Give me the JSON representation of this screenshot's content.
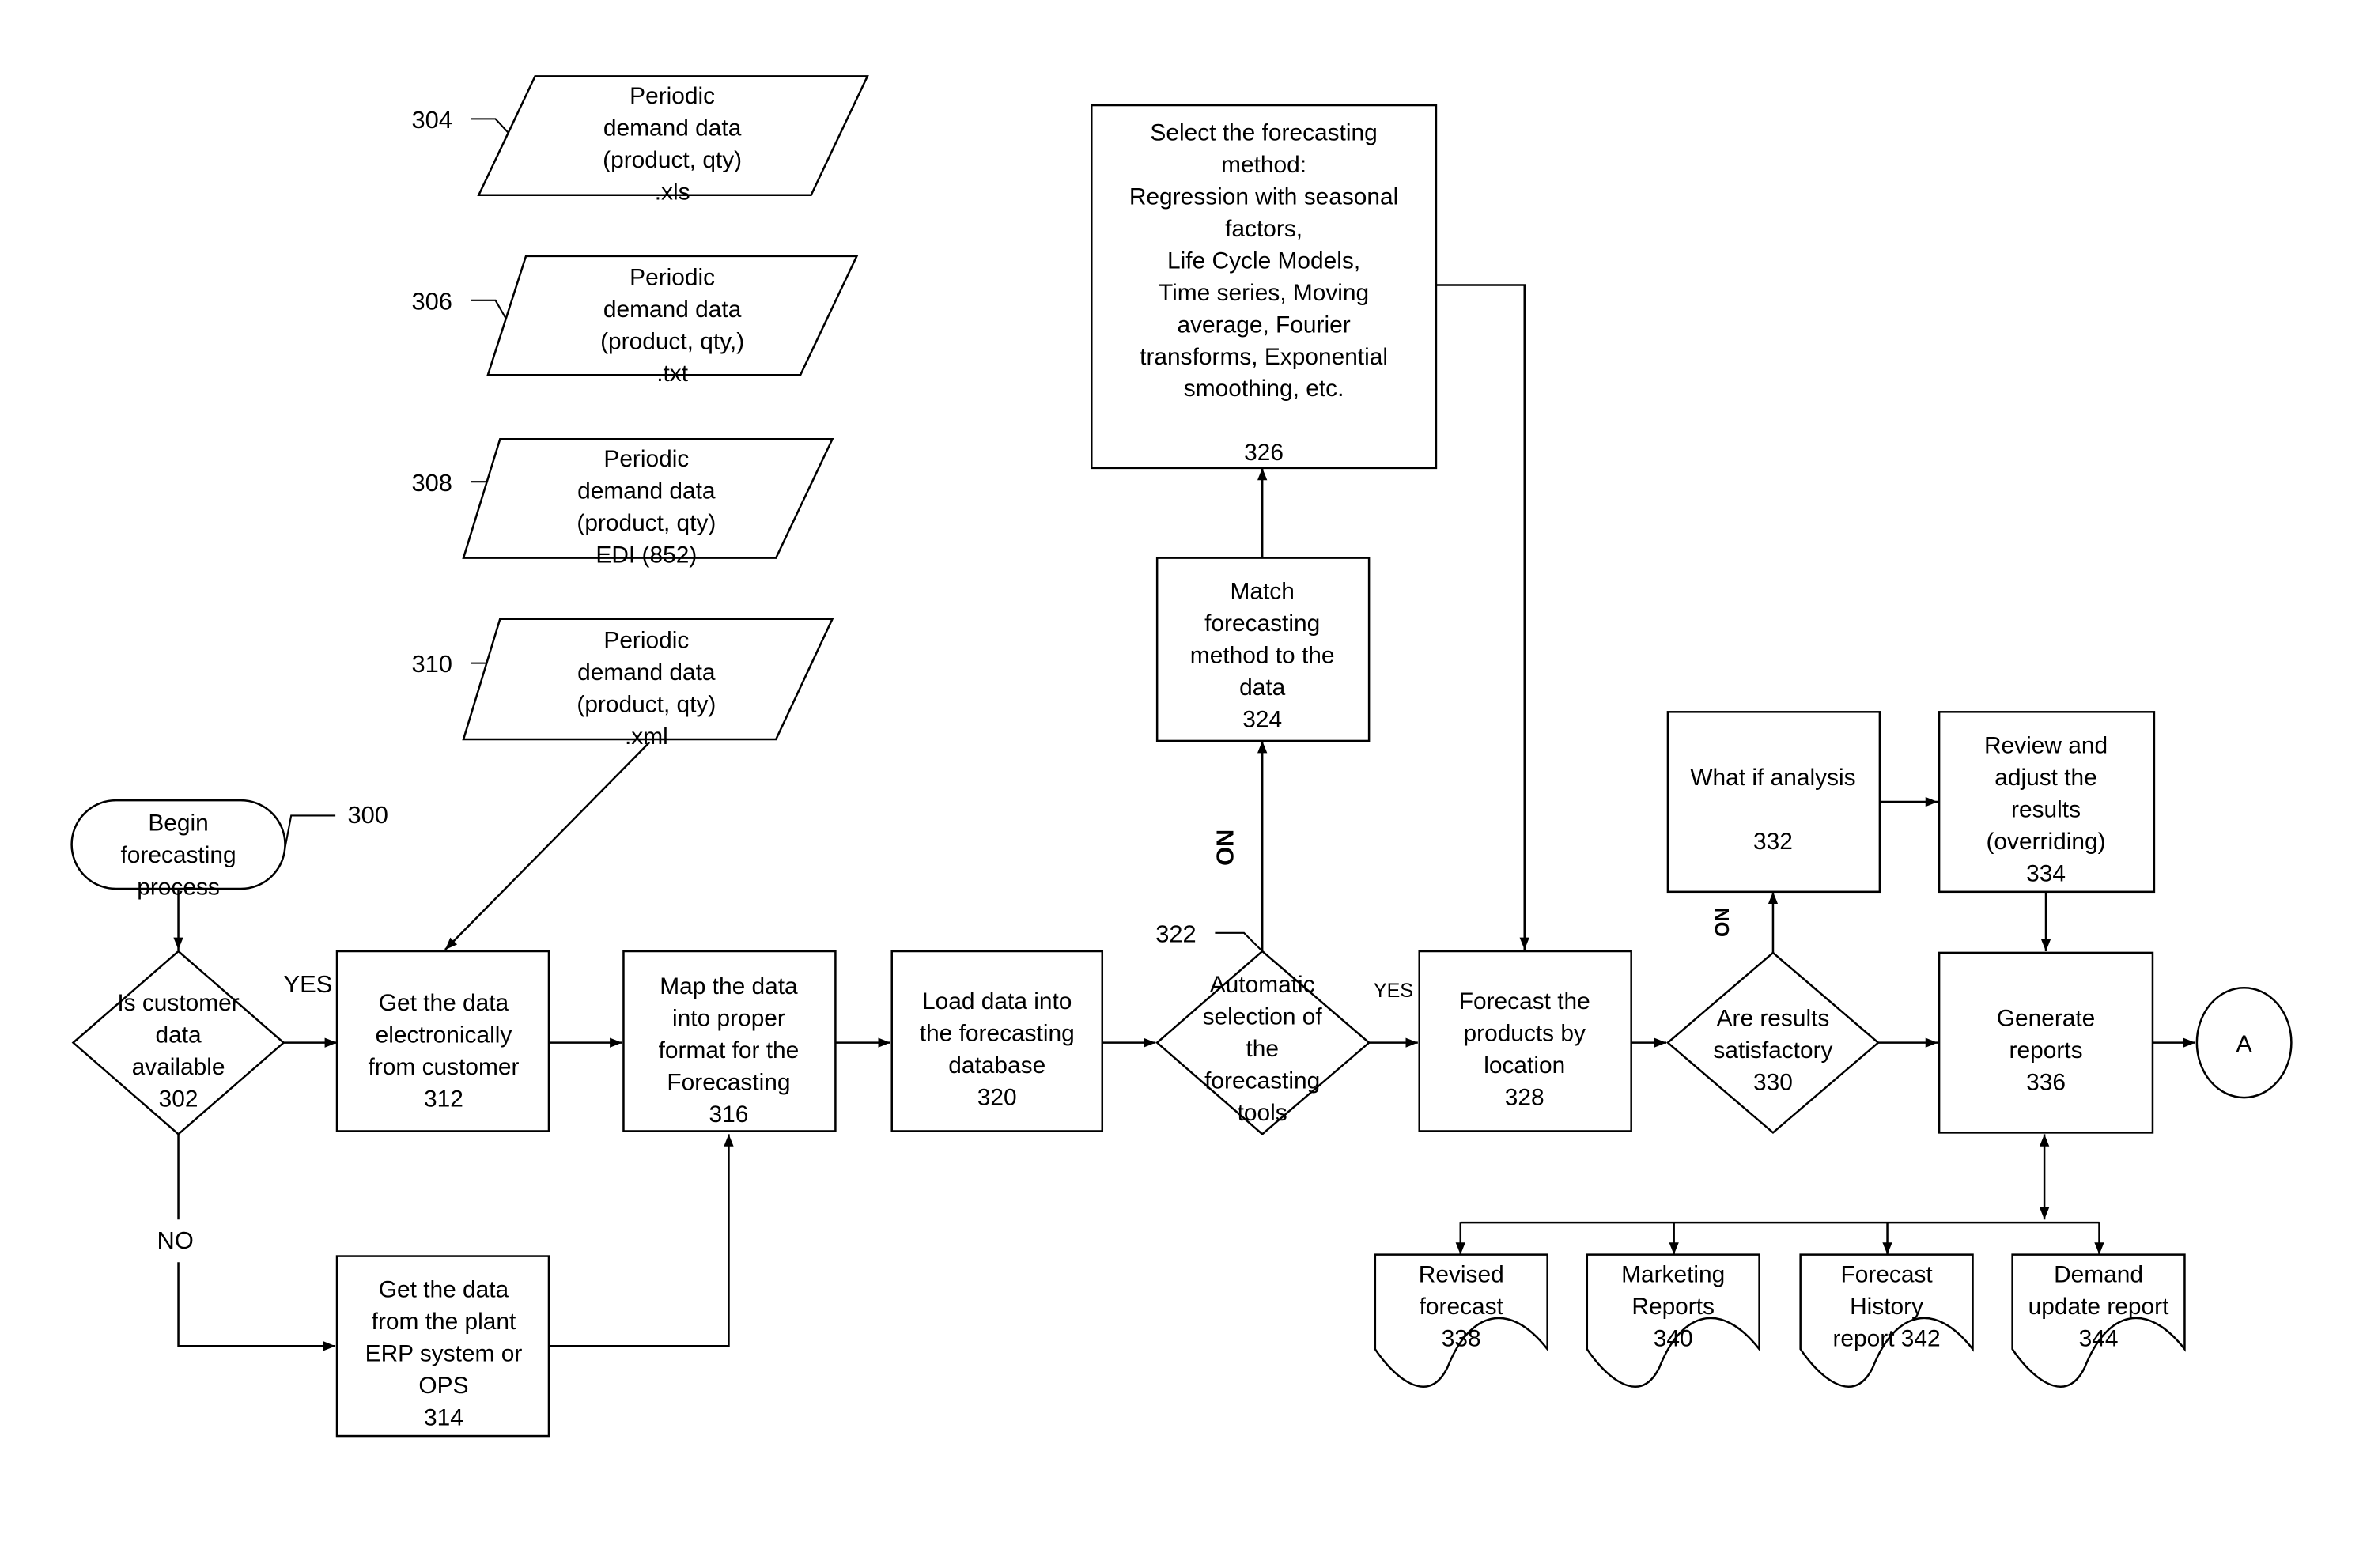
{
  "diagram": {
    "type": "flowchart",
    "colors": {
      "stroke": "#000000",
      "background": "#ffffff",
      "text": "#000000"
    },
    "inputs": [
      {
        "ref": "304",
        "lines": [
          "Periodic",
          "demand data",
          "(product, qty)",
          ".xls"
        ]
      },
      {
        "ref": "306",
        "lines": [
          "Periodic",
          "demand data",
          "(product, qty,)",
          ".txt"
        ]
      },
      {
        "ref": "308",
        "lines": [
          "Periodic",
          "demand data",
          "(product, qty)",
          "EDI (852)"
        ]
      },
      {
        "ref": "310",
        "lines": [
          "Periodic",
          "demand data",
          "(product, qty)",
          ".xml"
        ]
      }
    ],
    "start": {
      "ref": "300",
      "lines": [
        "Begin",
        "forecasting",
        "process"
      ]
    },
    "decision_302": {
      "lines": [
        "Is customer",
        "data",
        "available",
        "302"
      ],
      "yes": "YES",
      "no": "NO"
    },
    "box_312": {
      "lines": [
        "Get the data",
        "electronically",
        "from customer",
        "312"
      ]
    },
    "box_314": {
      "lines": [
        "Get the data",
        "from the plant",
        "ERP system or",
        "OPS",
        "314"
      ]
    },
    "box_316": {
      "lines": [
        "Map the data",
        "into proper",
        "format for the",
        "Forecasting",
        "316"
      ]
    },
    "box_320": {
      "lines": [
        "Load data into",
        "the forecasting",
        "database",
        "320"
      ]
    },
    "decision_322": {
      "ref": "322",
      "lines": [
        "Automatic",
        "selection of",
        "the",
        "forecasting",
        "tools"
      ],
      "yes": "YES",
      "no": "NO"
    },
    "box_324": {
      "lines": [
        "Match",
        "forecasting",
        "method to the",
        "data",
        "324"
      ]
    },
    "box_326": {
      "lines": [
        "Select the forecasting",
        "method:",
        "Regression with seasonal",
        "factors,",
        "Life Cycle Models,",
        "Time series, Moving",
        "average, Fourier",
        "transforms, Exponential",
        "smoothing, etc.",
        "",
        "326"
      ]
    },
    "box_328": {
      "lines": [
        "Forecast the",
        "products by",
        "location",
        "328"
      ]
    },
    "decision_330": {
      "lines": [
        "Are results",
        "satisfactory",
        "330"
      ],
      "no": "NO"
    },
    "box_332": {
      "lines": [
        "What if analysis",
        "",
        "332"
      ]
    },
    "box_334": {
      "lines": [
        "Review and",
        "adjust the",
        "results",
        "(overriding)",
        "334"
      ]
    },
    "box_336": {
      "lines": [
        "Generate",
        "reports",
        "336"
      ]
    },
    "connector": {
      "label": "A"
    },
    "reports": [
      {
        "lines": [
          "Revised",
          "forecast",
          "338"
        ]
      },
      {
        "lines": [
          "Marketing",
          "Reports",
          "340"
        ]
      },
      {
        "lines": [
          "Forecast",
          "History",
          "report  342"
        ]
      },
      {
        "lines": [
          "Demand",
          "update report",
          "344"
        ]
      }
    ]
  }
}
